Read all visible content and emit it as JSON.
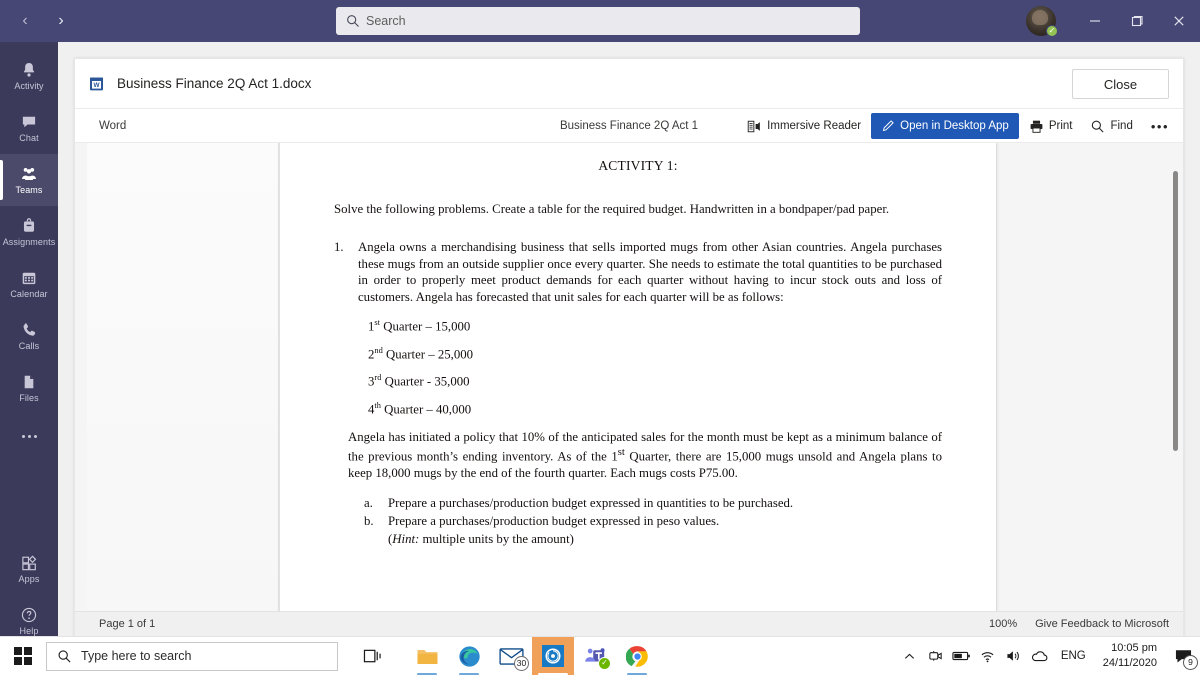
{
  "titlebar": {
    "back_label": "‹",
    "forward_label": "›",
    "search_placeholder": "Search",
    "minimize_label": "—",
    "maximize_label": "❐",
    "close_label": "✕",
    "presence_status": "available",
    "accent": "#464775"
  },
  "rail": {
    "items": [
      {
        "label": "Activity",
        "icon": "bell-icon",
        "selected": false
      },
      {
        "label": "Chat",
        "icon": "chat-icon",
        "selected": false
      },
      {
        "label": "Teams",
        "icon": "teams-icon",
        "selected": true
      },
      {
        "label": "Assignments",
        "icon": "assignments-icon",
        "selected": false
      },
      {
        "label": "Calendar",
        "icon": "calendar-icon",
        "selected": false
      },
      {
        "label": "Calls",
        "icon": "phone-icon",
        "selected": false
      },
      {
        "label": "Files",
        "icon": "files-icon",
        "selected": false
      }
    ],
    "more_label": "",
    "bottom": [
      {
        "label": "Apps",
        "icon": "apps-icon"
      },
      {
        "label": "Help",
        "icon": "help-icon"
      }
    ]
  },
  "document_window": {
    "file_name": "Business Finance 2Q Act 1.docx",
    "file_icon": "word-file-icon",
    "close_label": "Close",
    "toolbar": {
      "app_label": "Word",
      "doc_name": "Business Finance 2Q Act 1",
      "immersive_reader_label": "Immersive Reader",
      "open_desktop_label": "Open in Desktop App",
      "print_label": "Print",
      "find_label": "Find",
      "more_label": "•••",
      "primary_color": "#1f58b5"
    },
    "status": {
      "page_label": "Page 1 of 1",
      "zoom": "100%",
      "feedback_label": "Give Feedback to Microsoft"
    }
  },
  "doc_content": {
    "heading": "ACTIVITY 1:",
    "intro": "Solve the following problems. Create a table for the required budget. Handwritten in a bondpaper/pad paper.",
    "item_number": "1.",
    "item_text": "Angela owns a merchandising business that sells imported mugs from other Asian countries. Angela purchases these mugs from an outside supplier once every quarter. She needs to estimate the total quantities to be purchased in order to properly meet product demands for each quarter without having to incur stock outs and loss of customers. Angela has forecasted that unit sales for each quarter will be as follows:",
    "quarters": [
      {
        "ordinal": "1",
        "sup": "st",
        "rest": " Quarter – 15,000"
      },
      {
        "ordinal": "2",
        "sup": "nd",
        "rest": " Quarter – 25,000"
      },
      {
        "ordinal": "3",
        "sup": "rd",
        "rest": " Quarter - 35,000"
      },
      {
        "ordinal": "4",
        "sup": "th",
        "rest": " Quarter – 40,000"
      }
    ],
    "policy_p1": " Angela has initiated a policy that 10% of the anticipated sales for the month must be kept as a minimum balance of the previous month’s ending inventory. As of the 1",
    "policy_sup": "st",
    "policy_p2": " Quarter, there are 15,000 mugs unsold and Angela plans to keep 18,000 mugs by the end of the fourth quarter. Each mugs costs P75.00.",
    "subitems": [
      {
        "letter": "a.",
        "text": "Prepare a purchases/production budget expressed in quantities to be purchased."
      },
      {
        "letter": "b.",
        "text": "Prepare a purchases/production budget expressed in peso values."
      }
    ],
    "hint_label": "Hint:",
    "hint_text": " multiple units by the amount)",
    "hint_open": "("
  },
  "taskbar": {
    "start_icon": "windows-start-icon",
    "search_placeholder": "Type here to search",
    "search_icon": "search-icon",
    "task_view_icon": "task-view-icon",
    "apps": [
      {
        "name": "file-explorer",
        "icon": "folder-icon",
        "badge": "",
        "active": false,
        "running": true
      },
      {
        "name": "microsoft-edge",
        "icon": "edge-icon",
        "badge": "",
        "active": false,
        "running": true
      },
      {
        "name": "mail",
        "icon": "mail-icon",
        "badge": "30",
        "active": false,
        "running": false
      },
      {
        "name": "onedrive-sync-app",
        "icon": "blue-circle-icon",
        "badge": "",
        "active": true,
        "running": true
      },
      {
        "name": "microsoft-teams",
        "icon": "teams-icon",
        "badge": "check",
        "active": false,
        "running": false
      },
      {
        "name": "google-chrome",
        "icon": "chrome-icon",
        "badge": "",
        "active": false,
        "running": true
      }
    ],
    "tray": {
      "chevron": "⌃",
      "icons": [
        "camera-icon",
        "battery-icon",
        "wifi-icon",
        "volume-icon"
      ],
      "cloud_icon": "onedrive-cloud-icon",
      "language": "ENG",
      "time": "10:05 pm",
      "date": "24/11/2020",
      "notification_count": "9"
    }
  }
}
